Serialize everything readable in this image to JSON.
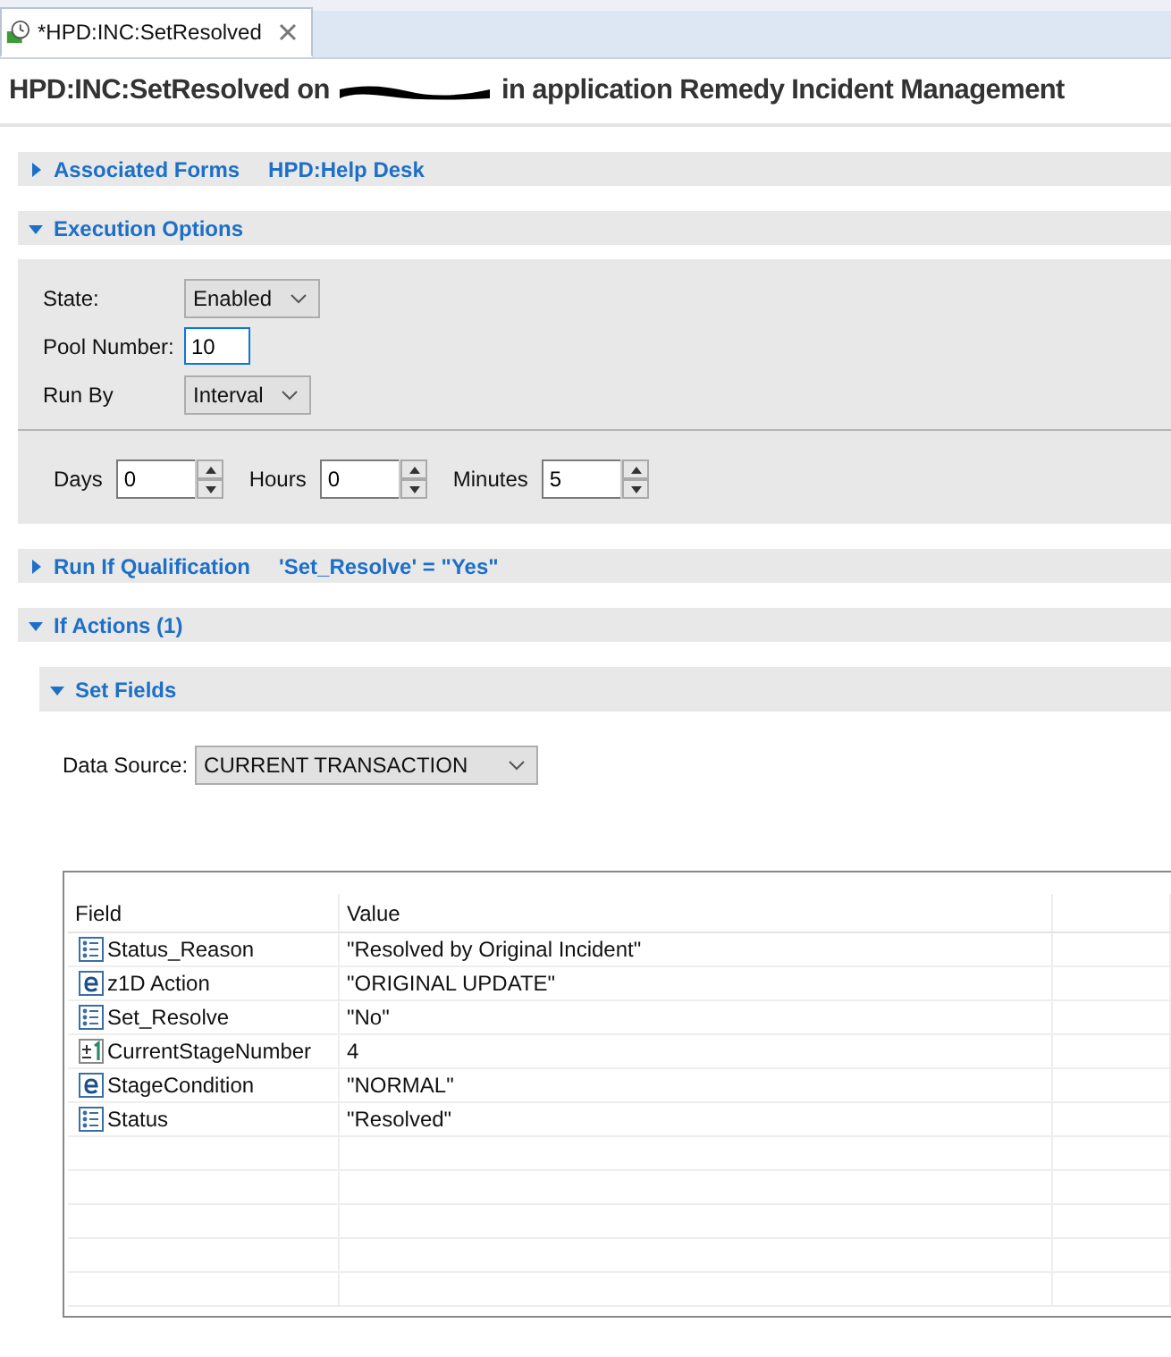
{
  "tab": {
    "label": "*HPD:INC:SetResolved",
    "selected": true
  },
  "title": {
    "before": "HPD:INC:SetResolved on",
    "after": "in application Remedy Incident Management"
  },
  "associated_forms": {
    "label": "Associated Forms",
    "expanded": false,
    "value": "HPD:Help Desk"
  },
  "execution_options": {
    "label": "Execution Options",
    "expanded": true,
    "state": {
      "label": "State:",
      "value": "Enabled"
    },
    "pool_number": {
      "label": "Pool Number:",
      "value": "10"
    },
    "run_by": {
      "label": "Run By",
      "value": "Interval"
    },
    "interval": [
      {
        "label": "Days",
        "value": "0"
      },
      {
        "label": "Hours",
        "value": "0"
      },
      {
        "label": "Minutes",
        "value": "5"
      }
    ]
  },
  "run_if": {
    "label": "Run If Qualification",
    "expanded": false,
    "value": "'Set_Resolve' = \"Yes\""
  },
  "if_actions": {
    "label": "If Actions (1)",
    "expanded": true,
    "set_fields": {
      "label": "Set Fields",
      "expanded": true,
      "data_source": {
        "label": "Data Source:",
        "value": "CURRENT TRANSACTION"
      },
      "table": {
        "columns": [
          "Field",
          "Value"
        ],
        "rows": [
          {
            "kind": "selection",
            "field": "Status_Reason",
            "value": "\"Resolved by Original Incident\""
          },
          {
            "kind": "character",
            "field": "z1D Action",
            "value": "\"ORIGINAL UPDATE\""
          },
          {
            "kind": "selection",
            "field": "Set_Resolve",
            "value": "\"No\""
          },
          {
            "kind": "integer",
            "field": "CurrentStageNumber",
            "value": "4"
          },
          {
            "kind": "character",
            "field": "StageCondition",
            "value": "\"NORMAL\""
          },
          {
            "kind": "selection",
            "field": "Status",
            "value": "\"Resolved\""
          }
        ]
      }
    }
  }
}
